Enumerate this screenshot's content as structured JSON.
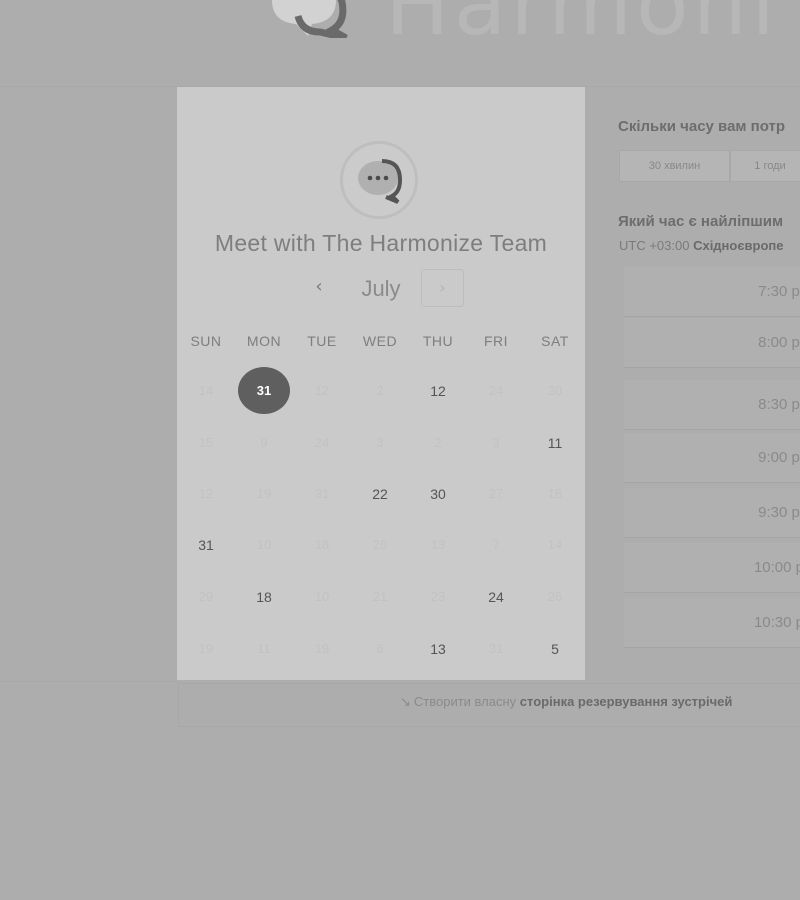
{
  "brand": {
    "name": "Harmoni",
    "logo_icon": "chat-bubble-icon"
  },
  "calendar": {
    "title": "Meet with The Harmonize Team",
    "month": "July",
    "prev_icon": "‹",
    "next_icon": "›",
    "weekdays": [
      "SUN",
      "MON",
      "TUE",
      "WED",
      "THU",
      "FRI",
      "SAT"
    ],
    "weeks": [
      [
        {
          "d": "14",
          "s": "off"
        },
        {
          "d": "31",
          "s": "sel"
        },
        {
          "d": "12",
          "s": "off"
        },
        {
          "d": "2",
          "s": "off"
        },
        {
          "d": "12",
          "s": "on"
        },
        {
          "d": "24",
          "s": "off"
        },
        {
          "d": "30",
          "s": "off"
        }
      ],
      [
        {
          "d": "15",
          "s": "off"
        },
        {
          "d": "9",
          "s": "off"
        },
        {
          "d": "24",
          "s": "off"
        },
        {
          "d": "3",
          "s": "off"
        },
        {
          "d": "2",
          "s": "off"
        },
        {
          "d": "3",
          "s": "off"
        },
        {
          "d": "11",
          "s": "on"
        }
      ],
      [
        {
          "d": "12",
          "s": "off"
        },
        {
          "d": "19",
          "s": "off"
        },
        {
          "d": "31",
          "s": "off"
        },
        {
          "d": "22",
          "s": "on"
        },
        {
          "d": "30",
          "s": "on"
        },
        {
          "d": "27",
          "s": "off"
        },
        {
          "d": "18",
          "s": "off"
        }
      ],
      [
        {
          "d": "31",
          "s": "on"
        },
        {
          "d": "10",
          "s": "off"
        },
        {
          "d": "18",
          "s": "off"
        },
        {
          "d": "26",
          "s": "off"
        },
        {
          "d": "13",
          "s": "off"
        },
        {
          "d": "7",
          "s": "off"
        },
        {
          "d": "14",
          "s": "off"
        }
      ],
      [
        {
          "d": "29",
          "s": "off"
        },
        {
          "d": "18",
          "s": "on"
        },
        {
          "d": "10",
          "s": "off"
        },
        {
          "d": "21",
          "s": "off"
        },
        {
          "d": "23",
          "s": "off"
        },
        {
          "d": "24",
          "s": "on"
        },
        {
          "d": "26",
          "s": "off"
        }
      ],
      [
        {
          "d": "19",
          "s": "off"
        },
        {
          "d": "11",
          "s": "off"
        },
        {
          "d": "19",
          "s": "off"
        },
        {
          "d": "6",
          "s": "off"
        },
        {
          "d": "13",
          "s": "on"
        },
        {
          "d": "31",
          "s": "off"
        },
        {
          "d": "5",
          "s": "on"
        }
      ]
    ]
  },
  "booking": {
    "duration_question": "Скільки часу вам потр",
    "durations": [
      "30 хвилин",
      "1 годи"
    ],
    "time_question": "Який час є найліпшим",
    "timezone_offset": "UTC +03:00",
    "timezone_name": "Східноєвропе",
    "slots": [
      "7:30 pı",
      "8:00 pı",
      "8:30 pı",
      "9:00 pı",
      "9:30 pı",
      "10:00 p",
      "10:30 p"
    ]
  },
  "footer": {
    "icon": "cursor-arrow-icon",
    "prefix": "Створити власну",
    "bold": "сторінка резервування зустрічей"
  }
}
